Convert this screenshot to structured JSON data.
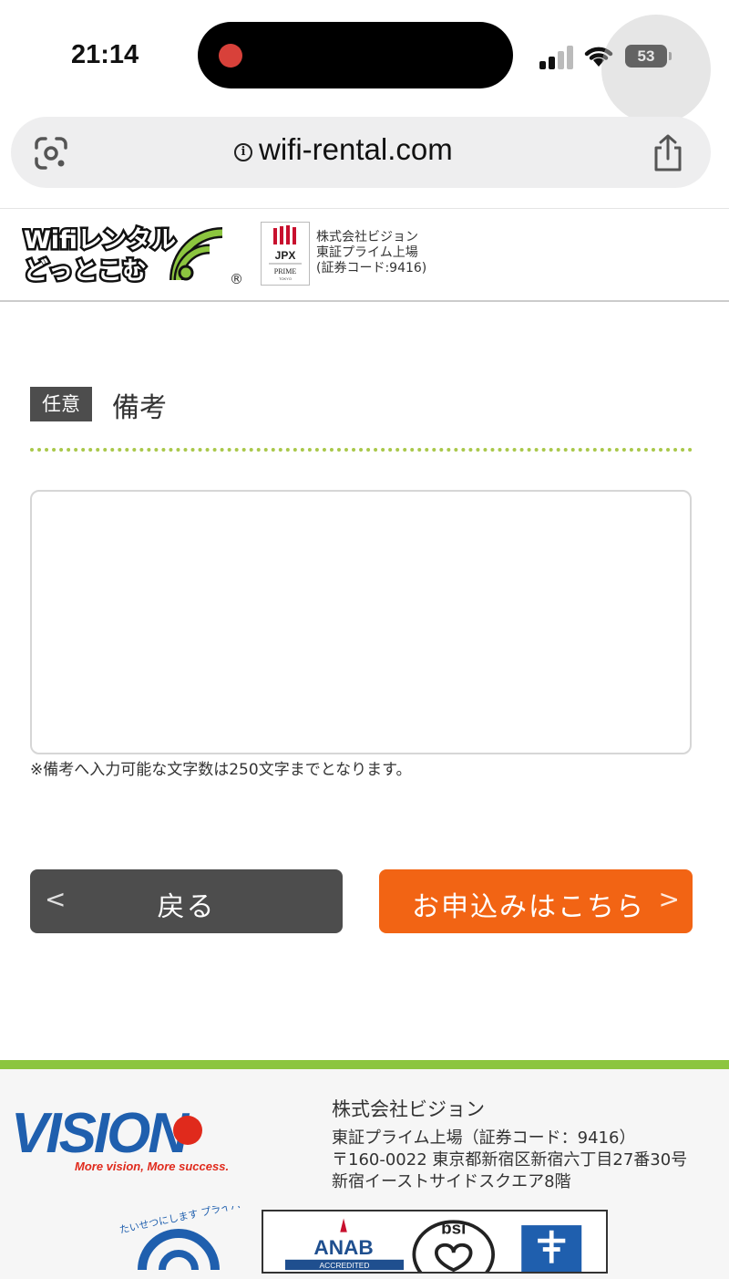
{
  "status_bar": {
    "time": "21:14",
    "battery": "53",
    "icons": [
      "cellular-signal-icon",
      "wifi-icon",
      "battery-icon"
    ],
    "recording_color": "#d8413a"
  },
  "browser": {
    "url": "wifi-rental.com",
    "info_icon": "i",
    "icons": [
      "google-lens-icon",
      "info-icon",
      "share-icon"
    ]
  },
  "site_header": {
    "logo_line1": "Wifiレンタル",
    "logo_line2": "どっとこむ",
    "logo_registered": "®",
    "jpx_mark": "JPX",
    "jpx_sub": "PRIME",
    "jpx_sub2": "TOKYO",
    "company_lines": [
      "株式会社ビジョン",
      "東証プライム上場",
      "(証券コード:9416)"
    ]
  },
  "form": {
    "badge": "任意",
    "field_title": "備考",
    "textarea_value": "",
    "note": "※備考へ入力可能な文字数は250文字までとなります。",
    "back_button": "戻る",
    "back_chevron": "<",
    "apply_button": "お申込みはこちら",
    "apply_chevron": ">"
  },
  "footer": {
    "vision_logo_text": "VISION",
    "vision_tagline": "More vision, More success.",
    "company_name": "株式会社ビジョン",
    "lines": [
      "東証プライム上場（証券コード：9416）",
      "〒160-0022 東京都新宿区新宿六丁目27番30号",
      "新宿イーストサイドスクエア8階"
    ],
    "privacy_text": "たいせつにします プライバシー",
    "cert_anab": "ANAB",
    "cert_anab_sub": "ACCREDITED",
    "cert_bsi": "bsi",
    "colors": {
      "accent_green": "#8cc53f",
      "vision_blue": "#1f5fae",
      "vision_red": "#e02a1c"
    }
  },
  "colors": {
    "apply_orange": "#f26414",
    "back_gray": "#4d4d4d",
    "dotted_green": "#a9c84a"
  }
}
